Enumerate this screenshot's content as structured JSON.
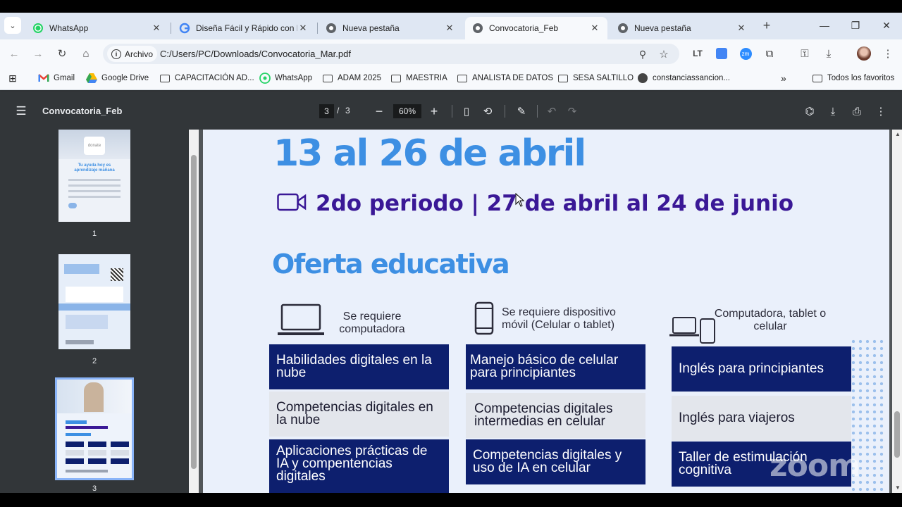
{
  "browser": {
    "tabs": [
      {
        "title": "WhatsApp",
        "icon": "whatsapp-icon"
      },
      {
        "title": "Diseña Fácil y Rápido con N",
        "icon": "google-icon"
      },
      {
        "title": "Nueva pestaña",
        "icon": "chrome-icon"
      },
      {
        "title": "Convocatoria_Feb",
        "icon": "chrome-icon",
        "active": true
      },
      {
        "title": "Nueva pestaña",
        "icon": "chrome-icon"
      }
    ],
    "address_chip": "Archivo",
    "url": "C:/Users/PC/Downloads/Convocatoria_Mar.pdf",
    "bookmarks": [
      "Gmail",
      "Google Drive",
      "CAPACITACIÓN AD...",
      "WhatsApp",
      "ADAM 2025",
      "MAESTRIA",
      "ANALISTA DE DATOS",
      "SESA SALTILLO",
      "constanciassancion..."
    ],
    "all_bookmarks": "Todos los favoritos",
    "more_bookmarks": "»"
  },
  "pdf": {
    "title": "Convocatoria_Feb",
    "current_page": "3",
    "separator": "/",
    "total_pages": "3",
    "zoom": "60%",
    "thumb_labels": [
      "1",
      "2",
      "3"
    ]
  },
  "thumb1": {
    "text": "donate",
    "heading": "Tu ayuda hoy es aprendizaje mañana"
  },
  "document": {
    "period1_dates": "13 al 26 de abril",
    "period2": "2do periodo | 27 de abril al 24 de junio",
    "oferta_title": "Oferta educativa",
    "columns": [
      {
        "requirement": "Se requiere computadora",
        "courses": [
          "Habilidades digitales en la nube",
          "Competencias digitales en la nube",
          "Aplicaciones prácticas de IA y compentencias digitales"
        ]
      },
      {
        "requirement": "Se requiere dispositivo móvil (Celular o tablet)",
        "courses": [
          "Manejo básico de celular para principiantes",
          "Competencias digitales intermedias en celular",
          "Competencias digitales y uso de IA en celular"
        ]
      },
      {
        "requirement": "Computadora, tablet o celular",
        "courses": [
          "Inglés para principiantes",
          "Inglés para viajeros",
          "Taller de estimulación cognitiva"
        ]
      }
    ],
    "watermark": "zoom"
  },
  "colors": {
    "accent_blue": "#3d8fe3",
    "purple": "#3a1896",
    "navy": "#0d1f6e"
  }
}
